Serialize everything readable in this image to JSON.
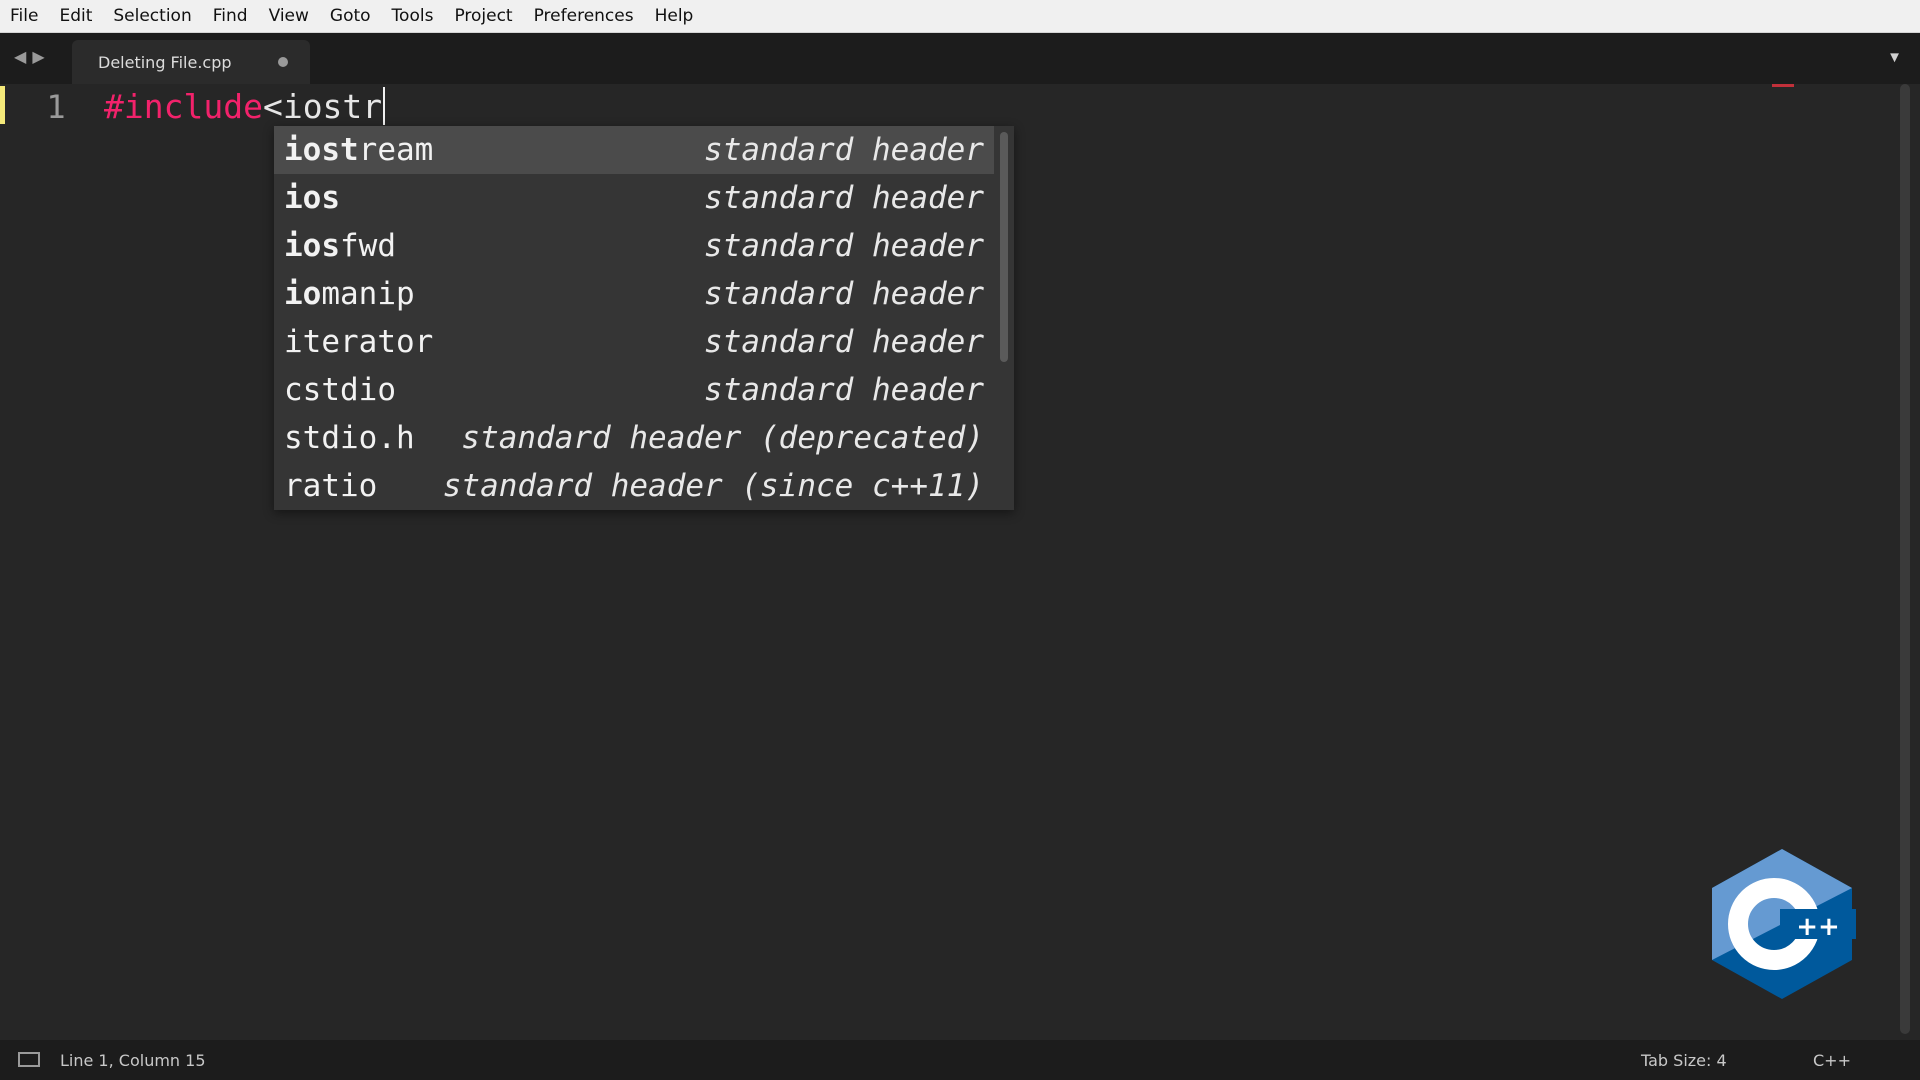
{
  "menubar": {
    "items": [
      "File",
      "Edit",
      "Selection",
      "Find",
      "View",
      "Goto",
      "Tools",
      "Project",
      "Preferences",
      "Help"
    ]
  },
  "tabbar": {
    "back_icon": "arrow-left-icon",
    "forward_icon": "arrow-right-icon",
    "active_tab": "Deleting File.cpp",
    "dropdown_icon": "triangle-down-icon"
  },
  "editor": {
    "line_number": "1",
    "directive": "#include",
    "typed_text": "<iostr"
  },
  "autocomplete": {
    "items": [
      {
        "match": "iost",
        "rest": "ream",
        "hint": "standard header",
        "selected": true
      },
      {
        "match": "ios",
        "rest": "",
        "hint": "standard header",
        "selected": false
      },
      {
        "match": "ios",
        "rest": "fwd",
        "hint": "standard header",
        "selected": false
      },
      {
        "match": "io",
        "rest": "manip",
        "hint": "standard header",
        "selected": false
      },
      {
        "match": "iterator",
        "rest": "",
        "hint": "standard header",
        "selected": false
      },
      {
        "match": "cstdio",
        "rest": "",
        "hint": "standard header",
        "selected": false
      },
      {
        "match": "stdio.h",
        "rest": "",
        "hint": "standard header (deprecated)",
        "selected": false
      },
      {
        "match": "ratio",
        "rest": "",
        "hint": "standard header (since c++11)",
        "selected": false
      }
    ]
  },
  "status": {
    "position": "Line 1, Column 15",
    "tab_size": "Tab Size: 4",
    "syntax": "C++"
  },
  "logo": {
    "icon": "cpp-logo-icon",
    "text": "C++"
  },
  "colors": {
    "directive": "#f2226b",
    "background": "#262626",
    "popup": "#353535",
    "logo_dark": "#00599c",
    "logo_light": "#659ad2"
  }
}
